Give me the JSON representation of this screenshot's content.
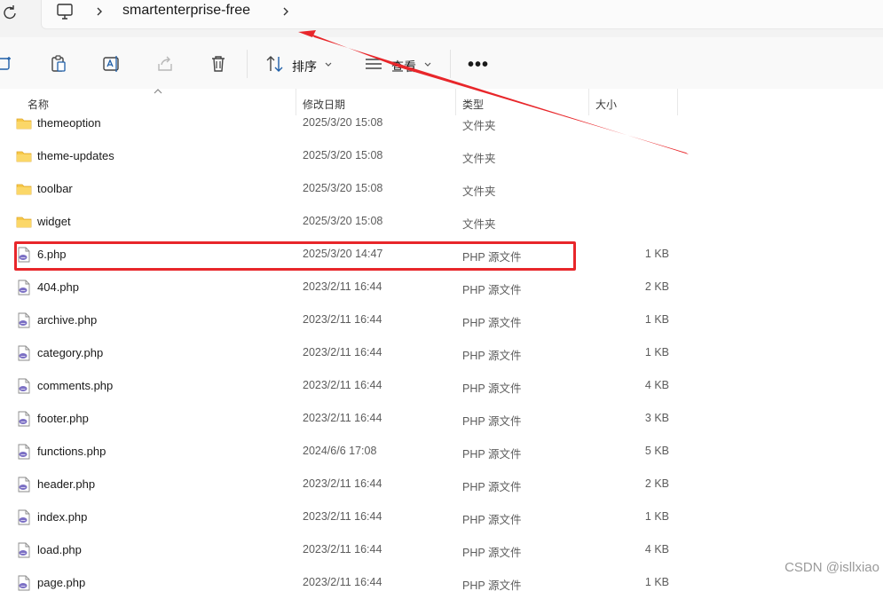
{
  "address": {
    "crumb": "smartenterprise-free",
    "icons": [
      "refresh-icon",
      "computer-icon",
      "chevron-right-icon"
    ]
  },
  "toolbar": {
    "sort_label": "排序",
    "view_label": "查看",
    "more_label": "•••",
    "icons": [
      "new-icon",
      "paste-icon",
      "rename-icon",
      "share-icon",
      "delete-icon",
      "sort-icon",
      "view-icon"
    ]
  },
  "columns": {
    "name": "名称",
    "modified": "修改日期",
    "type": "类型",
    "size": "大小"
  },
  "rows": [
    {
      "name": "themeoption",
      "modified": "2025/3/20 15:08",
      "type": "文件夹",
      "size": "",
      "kind": "folder"
    },
    {
      "name": "theme-updates",
      "modified": "2025/3/20 15:08",
      "type": "文件夹",
      "size": "",
      "kind": "folder"
    },
    {
      "name": "toolbar",
      "modified": "2025/3/20 15:08",
      "type": "文件夹",
      "size": "",
      "kind": "folder"
    },
    {
      "name": "widget",
      "modified": "2025/3/20 15:08",
      "type": "文件夹",
      "size": "",
      "kind": "folder"
    },
    {
      "name": "6.php",
      "modified": "2025/3/20 14:47",
      "type": "PHP 源文件",
      "size": "1 KB",
      "kind": "php"
    },
    {
      "name": "404.php",
      "modified": "2023/2/11 16:44",
      "type": "PHP 源文件",
      "size": "2 KB",
      "kind": "php"
    },
    {
      "name": "archive.php",
      "modified": "2023/2/11 16:44",
      "type": "PHP 源文件",
      "size": "1 KB",
      "kind": "php"
    },
    {
      "name": "category.php",
      "modified": "2023/2/11 16:44",
      "type": "PHP 源文件",
      "size": "1 KB",
      "kind": "php"
    },
    {
      "name": "comments.php",
      "modified": "2023/2/11 16:44",
      "type": "PHP 源文件",
      "size": "4 KB",
      "kind": "php"
    },
    {
      "name": "footer.php",
      "modified": "2023/2/11 16:44",
      "type": "PHP 源文件",
      "size": "3 KB",
      "kind": "php"
    },
    {
      "name": "functions.php",
      "modified": "2024/6/6 17:08",
      "type": "PHP 源文件",
      "size": "5 KB",
      "kind": "php"
    },
    {
      "name": "header.php",
      "modified": "2023/2/11 16:44",
      "type": "PHP 源文件",
      "size": "2 KB",
      "kind": "php"
    },
    {
      "name": "index.php",
      "modified": "2023/2/11 16:44",
      "type": "PHP 源文件",
      "size": "1 KB",
      "kind": "php"
    },
    {
      "name": "load.php",
      "modified": "2023/2/11 16:44",
      "type": "PHP 源文件",
      "size": "4 KB",
      "kind": "php"
    },
    {
      "name": "page.php",
      "modified": "2023/2/11 16:44",
      "type": "PHP 源文件",
      "size": "1 KB",
      "kind": "php"
    }
  ],
  "highlighted_row": "6.php",
  "watermark": "CSDN @isllxiao",
  "colors": {
    "annotation_red": "#e8262a",
    "folder_yellow": "#f7c948",
    "php_purple": "#7b6fc4"
  }
}
